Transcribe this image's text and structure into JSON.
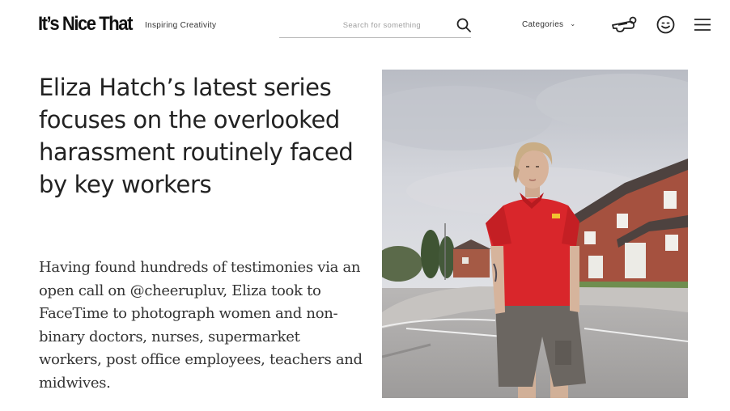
{
  "site": {
    "logo": "It’s Nice That",
    "tagline": "Inspiring Creativity"
  },
  "search": {
    "placeholder": "Search for something"
  },
  "nav": {
    "categories_label": "Categories",
    "chevron": "⌄"
  },
  "icons": {
    "search": "search-icon",
    "whistle": "whistle-icon",
    "smiley": "smiley-icon",
    "menu": "hamburger-menu-icon"
  },
  "article": {
    "headline": "Eliza Hatch’s latest series focuses on the overlooked harassment routinely faced by key workers",
    "standfirst": "Having found hundreds of testimonies via an open call on @cheerupluv, Eliza took to FaceTime to photograph women and non-binary doctors, nurses, supermarket workers, post office employees, teachers and midwives."
  },
  "colors": {
    "text": "#222222",
    "shirt": "#d9262b",
    "sky": "#c9ccd3",
    "brick": "#a5513f"
  }
}
